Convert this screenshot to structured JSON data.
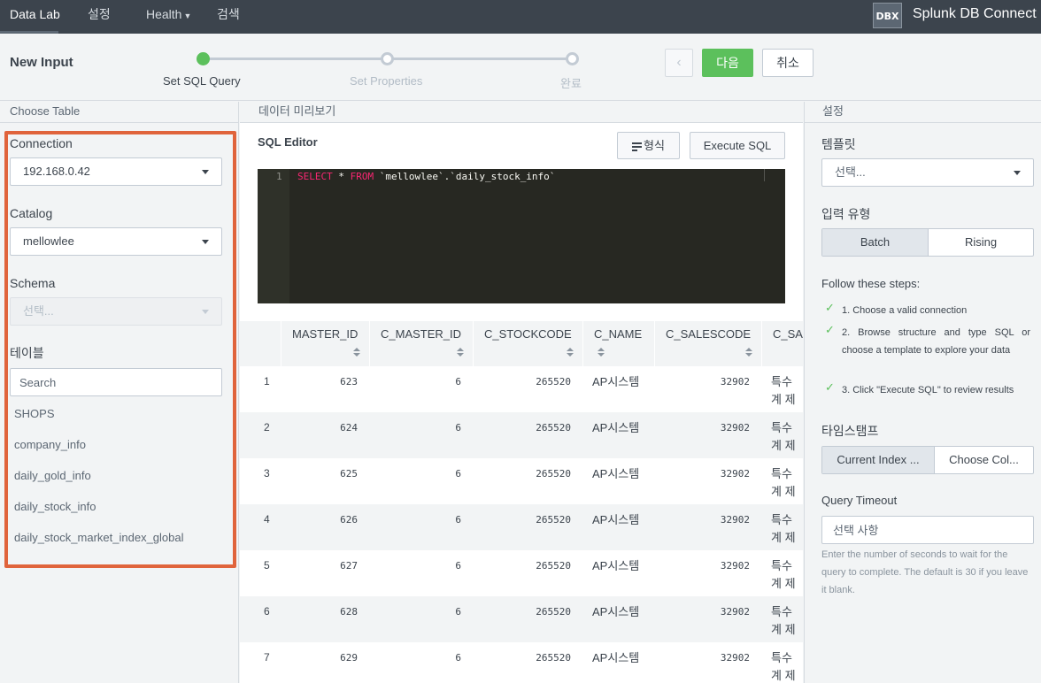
{
  "nav": {
    "items": [
      "Data Lab",
      "설정",
      "Health",
      "검색"
    ],
    "logo": "DBX",
    "app_name": "Splunk DB Connect"
  },
  "wizard": {
    "title": "New Input",
    "steps": [
      "Set SQL Query",
      "Set Properties",
      "완료"
    ],
    "next_label": "다음",
    "cancel_label": "취소",
    "prev_icon": "chevron-left-icon"
  },
  "left": {
    "header": "Choose Table",
    "connection_label": "Connection",
    "connection_value": "192.168.0.42",
    "catalog_label": "Catalog",
    "catalog_value": "mellowlee",
    "schema_label": "Schema",
    "schema_value": "선택...",
    "table_label": "테이블",
    "search_placeholder": "Search",
    "tables": [
      "SHOPS",
      "company_info",
      "daily_gold_info",
      "daily_stock_info",
      "daily_stock_market_index_global"
    ]
  },
  "center": {
    "header": "데이터 미리보기",
    "editor_title": "SQL Editor",
    "format_label": "형식",
    "execute_label": "Execute SQL",
    "code": {
      "line_no": "1",
      "kw1": "SELECT",
      "mid": " * ",
      "kw2": "FROM",
      "rest": " `mellowlee`.`daily_stock_info`"
    },
    "columns": [
      "MASTER_ID",
      "C_MASTER_ID",
      "C_STOCKCODE",
      "C_NAME",
      "C_SALESCODE",
      "C_SA"
    ],
    "rows": [
      {
        "n": "1",
        "master_id": "623",
        "c_master_id": "6",
        "stockcode": "265520",
        "name": "AP시스템",
        "salescode": "32902",
        "sa1": "특수",
        "sa2": "계 제"
      },
      {
        "n": "2",
        "master_id": "624",
        "c_master_id": "6",
        "stockcode": "265520",
        "name": "AP시스템",
        "salescode": "32902",
        "sa1": "특수",
        "sa2": "계 제"
      },
      {
        "n": "3",
        "master_id": "625",
        "c_master_id": "6",
        "stockcode": "265520",
        "name": "AP시스템",
        "salescode": "32902",
        "sa1": "특수",
        "sa2": "계 제"
      },
      {
        "n": "4",
        "master_id": "626",
        "c_master_id": "6",
        "stockcode": "265520",
        "name": "AP시스템",
        "salescode": "32902",
        "sa1": "특수",
        "sa2": "계 제"
      },
      {
        "n": "5",
        "master_id": "627",
        "c_master_id": "6",
        "stockcode": "265520",
        "name": "AP시스템",
        "salescode": "32902",
        "sa1": "특수",
        "sa2": "계 제"
      },
      {
        "n": "6",
        "master_id": "628",
        "c_master_id": "6",
        "stockcode": "265520",
        "name": "AP시스템",
        "salescode": "32902",
        "sa1": "특수",
        "sa2": "계 제"
      },
      {
        "n": "7",
        "master_id": "629",
        "c_master_id": "6",
        "stockcode": "265520",
        "name": "AP시스템",
        "salescode": "32902",
        "sa1": "특수",
        "sa2": "계 제"
      }
    ]
  },
  "right": {
    "header": "설정",
    "template_label": "템플릿",
    "template_value": "선택...",
    "input_type_label": "입력 유형",
    "input_types": [
      "Batch",
      "Rising"
    ],
    "steps_title": "Follow these steps:",
    "steps": [
      "1. Choose a valid connection",
      "2. Browse structure and type SQL or choose a template to explore your data",
      "3. Click \"Execute SQL\" to review results"
    ],
    "timestamp_label": "타임스탬프",
    "timestamp_options": [
      "Current Index ...",
      "Choose Col..."
    ],
    "timeout_label": "Query Timeout",
    "timeout_placeholder": "선택 사항",
    "timeout_help": "Enter the number of seconds to wait for the query to complete. The default is 30 if you leave it blank."
  },
  "colors": {
    "nav_bg": "#3c444d",
    "accent_green": "#5cc05c",
    "highlight_border": "#e0643c",
    "editor_bg": "#272822",
    "keyword": "#f92672"
  }
}
